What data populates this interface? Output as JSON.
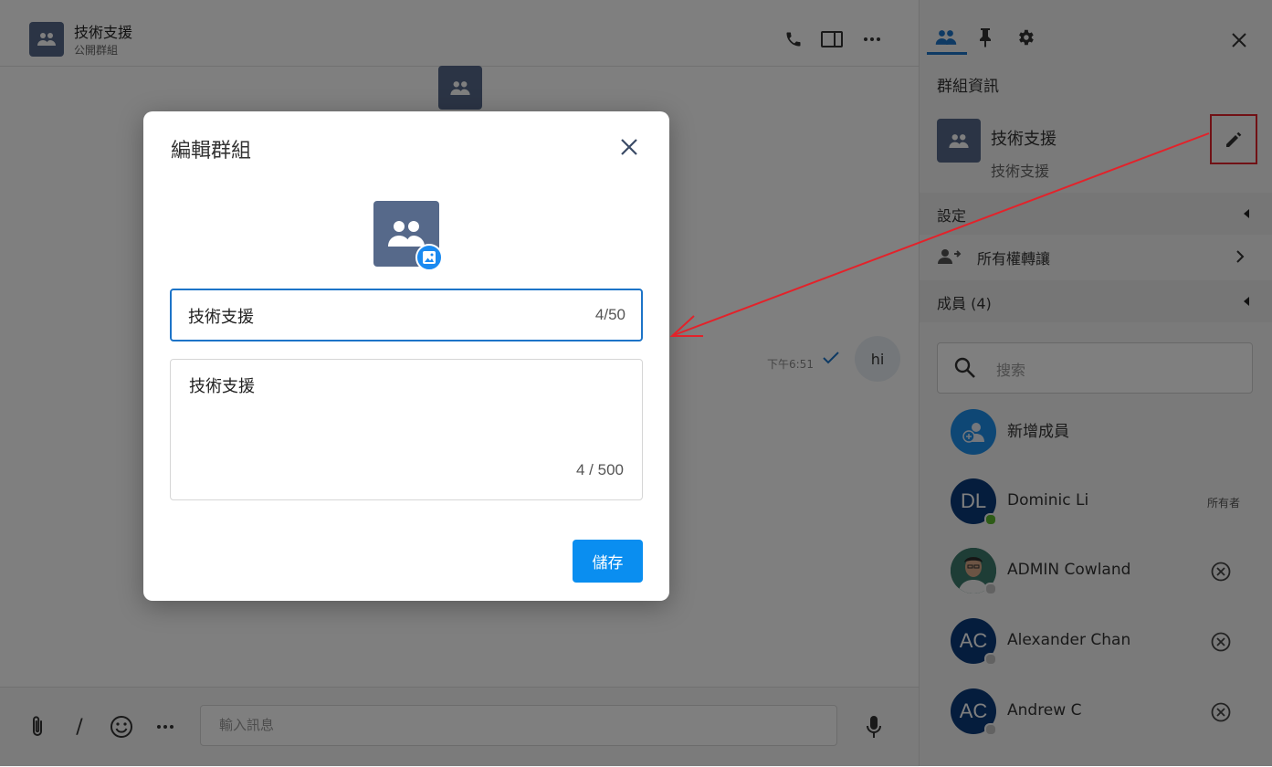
{
  "chat": {
    "title": "技術支援",
    "subtitle": "公開群組",
    "message": {
      "text": "hi",
      "time": "下午6:51"
    },
    "composer_placeholder": "輸入訊息",
    "composer_slash": "/"
  },
  "panel": {
    "section_title": "群組資訊",
    "group_name": "技術支援",
    "group_description": "技術支援",
    "settings_label": "設定",
    "transfer_label": "所有權轉讓",
    "members_label": "成員 (4)",
    "search_placeholder": "搜索",
    "add_member_label": "新增成員",
    "members": [
      {
        "initials": "DL",
        "name": "Dominic Li",
        "role": "所有者",
        "online": true
      },
      {
        "initials": "",
        "name": "ADMIN Cowland",
        "role": "",
        "online": false
      },
      {
        "initials": "AC",
        "name": "Alexander Chan",
        "role": "",
        "online": false
      },
      {
        "initials": "AC",
        "name": "Andrew C",
        "role": "",
        "online": false
      }
    ]
  },
  "modal": {
    "title": "編輯群組",
    "name_value": "技術支援",
    "name_counter": "4/50",
    "description_value": "技術支援",
    "description_counter": "4 / 500",
    "save_label": "儲存"
  },
  "colors": {
    "accent": "#0a8ef0",
    "group_avatar": "#56698a",
    "member_avatar": "#0b3a7a",
    "annotation": "#e3222a",
    "online": "#5cb82e"
  },
  "icons": {
    "header": [
      "phone-icon",
      "split-view-icon",
      "more-icon"
    ],
    "tabs": [
      "members-icon",
      "pin-icon",
      "gear-icon"
    ],
    "composer": [
      "paperclip-icon",
      "emoji-icon",
      "more-icon",
      "microphone-icon"
    ]
  }
}
